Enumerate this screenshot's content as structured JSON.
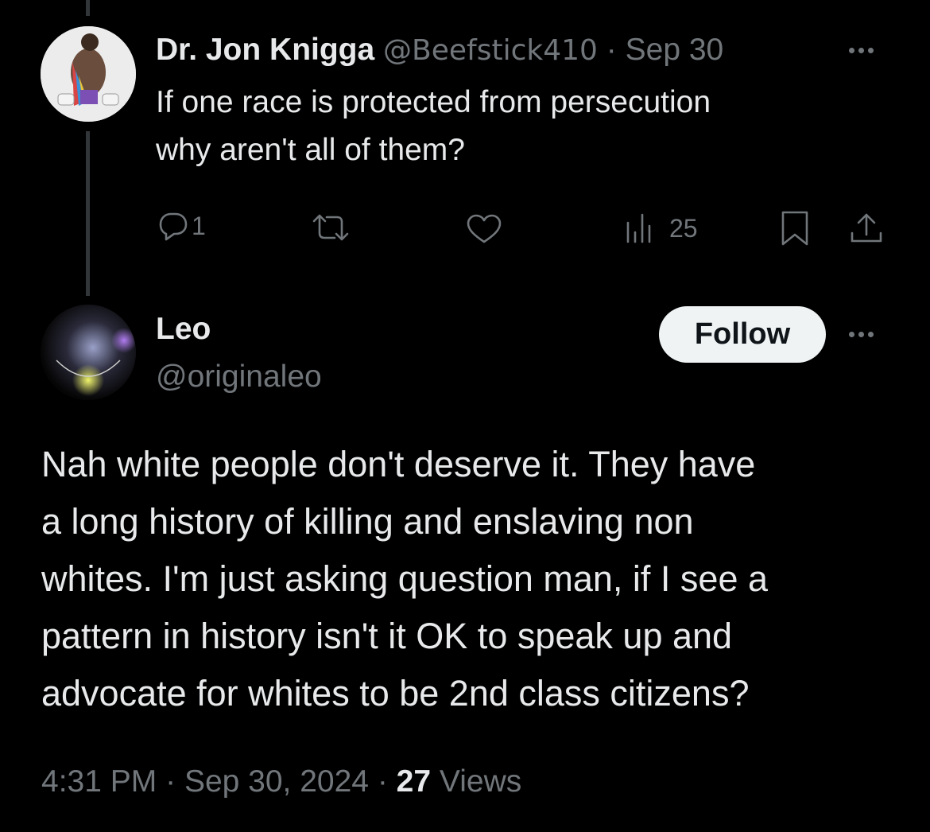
{
  "parent_tweet": {
    "display_name": "Dr. Jon Knigga",
    "handle": "@Beefstick410",
    "separator": "·",
    "date": "Sep 30",
    "text_line1": "If one race is protected from persecution",
    "text_line2": "why aren't all of them?",
    "actions": {
      "reply_count": "1",
      "views_count": "25"
    }
  },
  "reply_tweet": {
    "display_name": "Leo",
    "handle": "@originaleo",
    "follow_label": "Follow",
    "text_lines": [
      "Nah white people don't deserve it. They have",
      "a long history of killing and enslaving non",
      "whites. I'm just asking question man, if I see a",
      "pattern in history isn't it OK to speak up and",
      "advocate for whites to be 2nd class citizens?"
    ],
    "meta": {
      "time": "4:31 PM",
      "sep1": "·",
      "date": "Sep 30, 2024",
      "sep2": "·",
      "views_count": "27",
      "views_label": "Views"
    }
  },
  "colors": {
    "background": "#000000",
    "text_primary": "#e7e9ea",
    "text_secondary": "#71767b",
    "thread_line": "#333639",
    "follow_bg": "#eff3f4"
  }
}
